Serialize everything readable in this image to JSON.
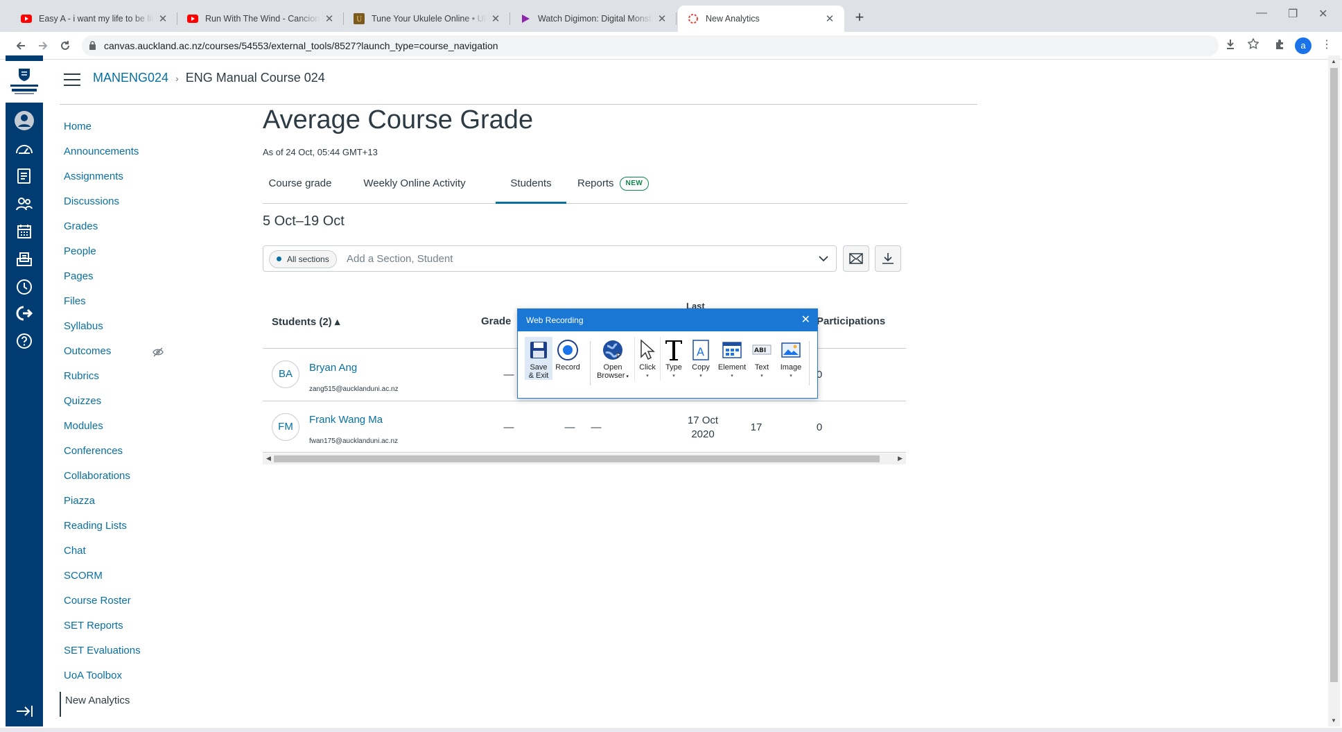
{
  "browser": {
    "tabs": [
      {
        "title": "Easy A - i want my life to be like",
        "icon": "youtube-icon",
        "active": false
      },
      {
        "title": "Run With The Wind - Cancion de",
        "icon": "youtube-icon",
        "active": false
      },
      {
        "title": "Tune Your Ukulele Online • UkuT",
        "icon": "ukutabs-icon",
        "active": false
      },
      {
        "title": "Watch Digimon: Digital Monsters",
        "icon": "play-icon",
        "active": false
      },
      {
        "title": "New Analytics",
        "icon": "canvas-icon",
        "active": true
      }
    ],
    "url": "canvas.auckland.ac.nz/courses/54553/external_tools/8527?launch_type=course_navigation",
    "profile_initial": "a"
  },
  "breadcrumb": {
    "course_code": "MANENG024",
    "course_name": "ENG Manual Course 024"
  },
  "course_nav": [
    "Home",
    "Announcements",
    "Assignments",
    "Discussions",
    "Grades",
    "People",
    "Pages",
    "Files",
    "Syllabus",
    "Outcomes",
    "Rubrics",
    "Quizzes",
    "Modules",
    "Conferences",
    "Collaborations",
    "Piazza",
    "Reading Lists",
    "Chat",
    "SCORM",
    "Course Roster",
    "SET Reports",
    "SET Evaluations",
    "UoA Toolbox",
    "New Analytics"
  ],
  "main": {
    "title": "Average Course Grade",
    "as_of": "As of 24 Oct, 05:44 GMT+13",
    "tabs": {
      "course_grade": "Course grade",
      "weekly": "Weekly Online Activity",
      "students": "Students",
      "reports": "Reports",
      "new_badge": "NEW"
    },
    "date_range": "5 Oct–19 Oct",
    "filter": {
      "chip": "All sections",
      "placeholder": "Add a Section, Student"
    },
    "table": {
      "headers": {
        "students": "Students (2) ▴",
        "grade": "Grade",
        "last": "Last",
        "participations": "Participations"
      },
      "rows": [
        {
          "initials": "BA",
          "name": "Bryan Ang",
          "email": "zang515@aucklanduni.ac.nz",
          "grade": "—",
          "participations_partial": "0"
        },
        {
          "initials": "FM",
          "name": "Frank Wang Ma",
          "email": "fwan175@aucklanduni.ac.nz",
          "grade": "—",
          "c2": "—",
          "c3": "—",
          "last_line1": "17 Oct",
          "last_line2": "2020",
          "page_views": "17",
          "participations": "0"
        }
      ]
    }
  },
  "web_recording": {
    "title": "Web Recording",
    "tools": {
      "save_exit_1": "Save",
      "save_exit_2": "& Exit",
      "record": "Record",
      "open_browser_1": "Open",
      "open_browser_2": "Browser",
      "click": "Click",
      "type": "Type",
      "copy": "Copy",
      "element": "Element",
      "text": "Text",
      "image": "Image"
    },
    "text_icon_label": "ABI"
  }
}
